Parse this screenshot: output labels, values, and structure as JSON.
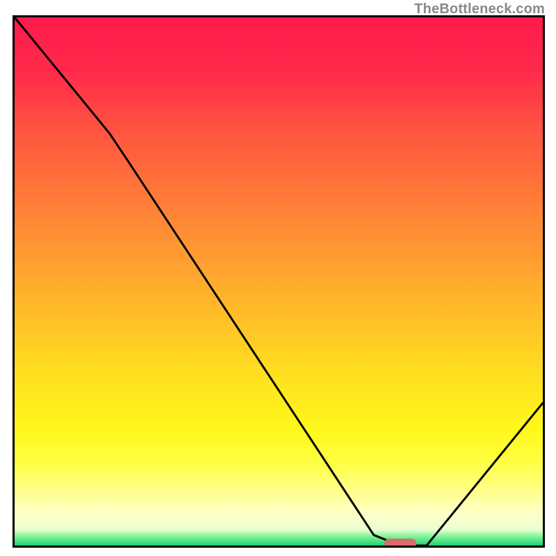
{
  "watermark": "TheBottleneck.com",
  "chart_data": {
    "type": "line",
    "title": "",
    "xlabel": "",
    "ylabel": "",
    "xlim": [
      0,
      100
    ],
    "ylim": [
      0,
      100
    ],
    "grid": false,
    "series": [
      {
        "name": "bottleneck-curve",
        "x": [
          0,
          18,
          22,
          68,
          73,
          78,
          100
        ],
        "values": [
          100,
          78,
          72,
          2,
          0,
          0,
          27
        ]
      }
    ],
    "marker": {
      "name": "optimal-zone",
      "x_center": 73,
      "y": 0,
      "width_pct": 6,
      "color": "#d86b6b"
    },
    "background_gradient": {
      "top": "#ff1a4d",
      "mid": "#ffe020",
      "bottom": "#1ed070"
    },
    "frame_color": "#000000",
    "line_color": "#000000"
  }
}
